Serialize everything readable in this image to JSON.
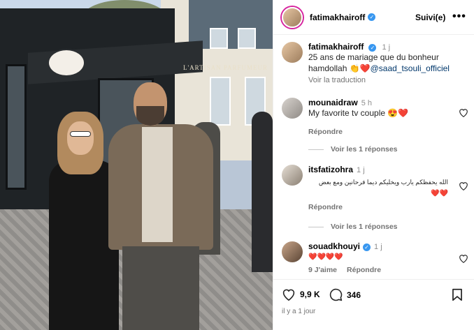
{
  "post": {
    "author": "fatimakhairoff",
    "follow_label": "Suivi(e)",
    "more_label": "•••",
    "caption_time": "1 j",
    "caption_line1": "25 ans de mariage que du bonheur",
    "caption_line2_prefix": "hamdollah 👏❤️",
    "caption_mention": "@saad_tsouli_officiel",
    "see_translation": "Voir la traduction",
    "photo_shop_name": "L'ARTISAN PARFUMEUR"
  },
  "comments": [
    {
      "user": "mounaidraw",
      "time": "5 h",
      "text": "My favorite tv couple 😍❤️",
      "reply_label": "Répondre",
      "view_replies": "Voir les 1 réponses"
    },
    {
      "user": "itsfatizohra",
      "time": "1 j",
      "text": "الله يحفظكم يارب ويخليكم ديما فرحانين ومع بعض",
      "text2": "❤️❤️",
      "reply_label": "Répondre",
      "view_replies": "Voir les 1 réponses"
    },
    {
      "user": "souadkhouyi",
      "time": "1 j",
      "text": "❤️❤️❤️❤️",
      "likes": "9 J'aime",
      "reply_label": "Répondre"
    }
  ],
  "stats": {
    "likes": "9,9 K",
    "comments": "346",
    "posted": "il y a 1 jour"
  },
  "colors": {
    "verified": "#3897f0",
    "mention": "#00376b",
    "muted": "#737373"
  }
}
